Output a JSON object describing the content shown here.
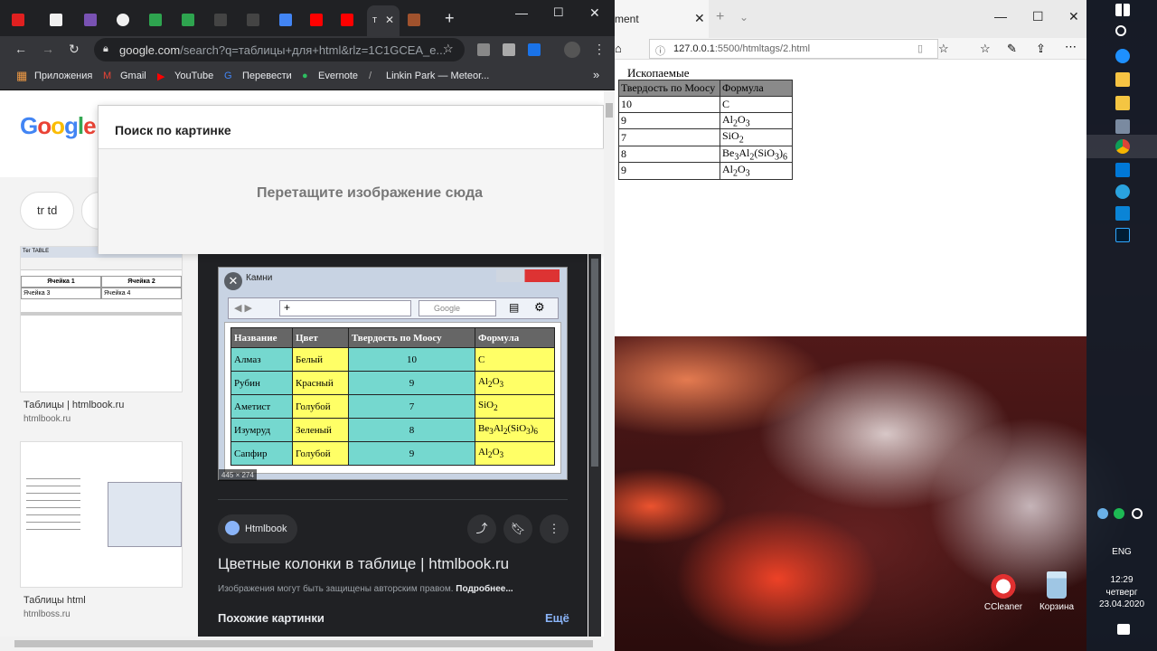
{
  "chrome": {
    "tabs": [
      {
        "name": "tab-1",
        "color": "#e02020"
      },
      {
        "name": "tab-2",
        "color": "#f0f0f0"
      },
      {
        "name": "tab-3",
        "color": "#7952b3"
      },
      {
        "name": "tab-4",
        "color": "#f0f0f0"
      },
      {
        "name": "tab-5",
        "color": "#2ea44f"
      },
      {
        "name": "tab-6",
        "color": "#2ea44f"
      },
      {
        "name": "tab-7",
        "color": "#444"
      },
      {
        "name": "tab-8",
        "color": "#4285f4"
      },
      {
        "name": "tab-9",
        "color": "#ff0000"
      },
      {
        "name": "tab-10",
        "color": "#ff0000"
      },
      {
        "name": "tab-11",
        "color": "#a0522d"
      }
    ],
    "active_tab_label": "т",
    "new_tab_symbol": "+",
    "url_host": "google.com",
    "url_path": "/search?q=таблицы+для+html&rlz=1C1GCEA_e...",
    "bookmarks": [
      "Приложения",
      "Gmail",
      "YouTube",
      "Перевести",
      "Evernote",
      "Linkin Park — Meteor..."
    ],
    "more_bookmarks": "»"
  },
  "google": {
    "logo": "Google",
    "chips": [
      "tr td",
      ""
    ],
    "results": [
      {
        "caption": "Таблицы | htmlbook.ru",
        "source": "htmlbook.ru"
      },
      {
        "caption": "Таблицы html",
        "source": "htmlboss.ru"
      }
    ],
    "thumb1_title": "Тег TABLE",
    "thumb1_cells": [
      "Ячейка 1",
      "Ячейка 2",
      "Ячейка 3",
      "Ячейка 4"
    ]
  },
  "popup": {
    "title": "Поиск по картинке",
    "drop_text": "Перетащите изображение сюда"
  },
  "detail": {
    "window_title": "Камни",
    "search_placeholder": "Google",
    "dimensions": "445 × 274",
    "headers": [
      "Название",
      "Цвет",
      "Твердость по Моосу",
      "Формула"
    ],
    "rows": [
      [
        "Алмаз",
        "Белый",
        "10",
        "C"
      ],
      [
        "Рубин",
        "Красный",
        "9",
        "Al2O3"
      ],
      [
        "Аметист",
        "Голубой",
        "7",
        "SiO2"
      ],
      [
        "Изумруд",
        "Зеленый",
        "8",
        "Be3Al2(SiO3)6"
      ],
      [
        "Сапфир",
        "Голубой",
        "9",
        "Al2O3"
      ]
    ],
    "source_label": "Htmlbook",
    "title": "Цветные колонки в таблице | htmlbook.ru",
    "note": "Изображения могут быть защищены авторским правом.",
    "note_link": "Подробнее...",
    "similar": "Похожие картинки",
    "all": "Ещё"
  },
  "edge": {
    "tab_label": "ment",
    "url_host": "127.0.0.1",
    "url_path": ":5500/htmltags/2.html",
    "caption": "Ископаемые",
    "headers": [
      "Твердость по Моосу",
      "Формула"
    ],
    "rows": [
      [
        "10",
        "C"
      ],
      [
        "9",
        "Al2O3"
      ],
      [
        "7",
        "SiO2"
      ],
      [
        "8",
        "Be3Al2(SiO3)6"
      ],
      [
        "9",
        "Al2O3"
      ]
    ]
  },
  "desktop": {
    "icons": [
      "CCleaner",
      "Корзина"
    ]
  },
  "tray": {
    "lang": "ENG",
    "time": "12:29",
    "day": "четверг",
    "date": "23.04.2020"
  }
}
